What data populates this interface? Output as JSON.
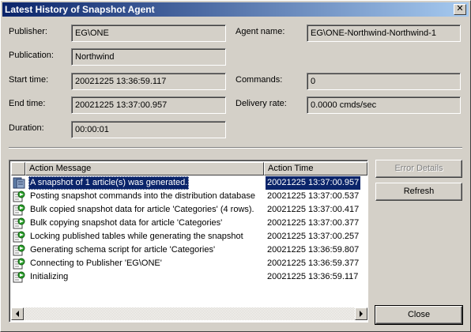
{
  "window": {
    "title": "Latest History of Snapshot Agent",
    "close_glyph": "✕"
  },
  "fields": {
    "publisher_label": "Publisher:",
    "publisher_value": "EG\\ONE",
    "publication_label": "Publication:",
    "publication_value": "Northwind",
    "start_label": "Start time:",
    "start_value": "20021225 13:36:59.117",
    "end_label": "End time:",
    "end_value": "20021225 13:37:00.957",
    "duration_label": "Duration:",
    "duration_value": "00:00:01",
    "agent_label": "Agent name:",
    "agent_value": "EG\\ONE-Northwind-Northwind-1",
    "commands_label": "Commands:",
    "commands_value": "0",
    "delivery_label": "Delivery rate:",
    "delivery_value": "0.0000 cmds/sec"
  },
  "list": {
    "col_message": "Action Message",
    "col_time": "Action Time",
    "rows": [
      {
        "message": "A snapshot of 1 article(s) was generated.",
        "time": "20021225 13:37:00.957",
        "icon": "snapshot-generated-icon",
        "selected": true
      },
      {
        "message": "Posting snapshot commands into the distribution database",
        "time": "20021225 13:37:00.537",
        "icon": "agent-action-icon"
      },
      {
        "message": "Bulk copied snapshot data for article 'Categories' (4 rows).",
        "time": "20021225 13:37:00.417",
        "icon": "agent-action-icon"
      },
      {
        "message": "Bulk copying snapshot data for article 'Categories'",
        "time": "20021225 13:37:00.377",
        "icon": "agent-action-icon"
      },
      {
        "message": "Locking published tables while generating the snapshot",
        "time": "20021225 13:37:00.257",
        "icon": "agent-action-icon"
      },
      {
        "message": "Generating schema script for article 'Categories'",
        "time": "20021225 13:36:59.807",
        "icon": "agent-action-icon"
      },
      {
        "message": "Connecting to Publisher 'EG\\ONE'",
        "time": "20021225 13:36:59.377",
        "icon": "agent-action-icon"
      },
      {
        "message": "Initializing",
        "time": "20021225 13:36:59.117",
        "icon": "agent-action-icon"
      }
    ]
  },
  "buttons": {
    "error_details": "Error Details",
    "refresh": "Refresh",
    "close": "Close"
  },
  "scrollbar": {
    "left_arrow": "◀",
    "right_arrow": "▶"
  },
  "colors": {
    "selection": "#0a246a",
    "titlebar": "#0a246a",
    "face": "#d4d0c8"
  }
}
